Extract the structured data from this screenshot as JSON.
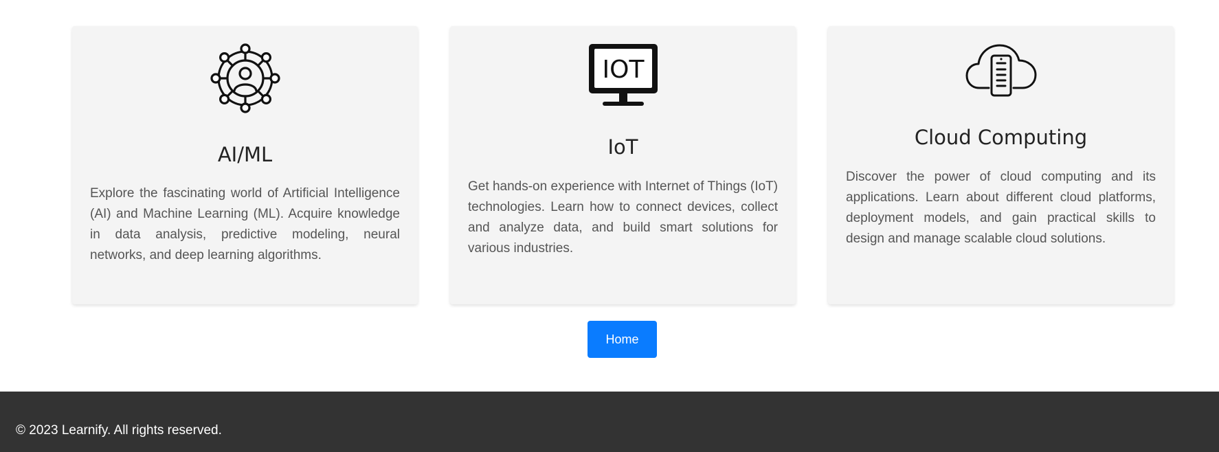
{
  "cards": [
    {
      "icon": "neural-network-person-icon",
      "title": "AI/ML",
      "description": "Explore the fascinating world of Artificial Intelligence (AI) and Machine Learning (ML). Acquire knowledge in data analysis, predictive modeling, neural networks, and deep learning algorithms."
    },
    {
      "icon": "iot-monitor-icon",
      "icon_text": "IOT",
      "title": "IoT",
      "description": "Get hands-on experience with Internet of Things (IoT) technologies. Learn how to connect devices, collect and analyze data, and build smart solutions for various industries."
    },
    {
      "icon": "cloud-server-icon",
      "title": "Cloud Computing",
      "description": "Discover the power of cloud computing and its applications. Learn about different cloud platforms, deployment models, and gain practical skills to design and manage scalable cloud solutions."
    }
  ],
  "home_button": {
    "label": "Home"
  },
  "footer": {
    "text": "© 2023 Learnify. All rights reserved."
  },
  "colors": {
    "card_background": "#f4f4f4",
    "button": "#0a7cff",
    "footer_background": "#333333"
  }
}
